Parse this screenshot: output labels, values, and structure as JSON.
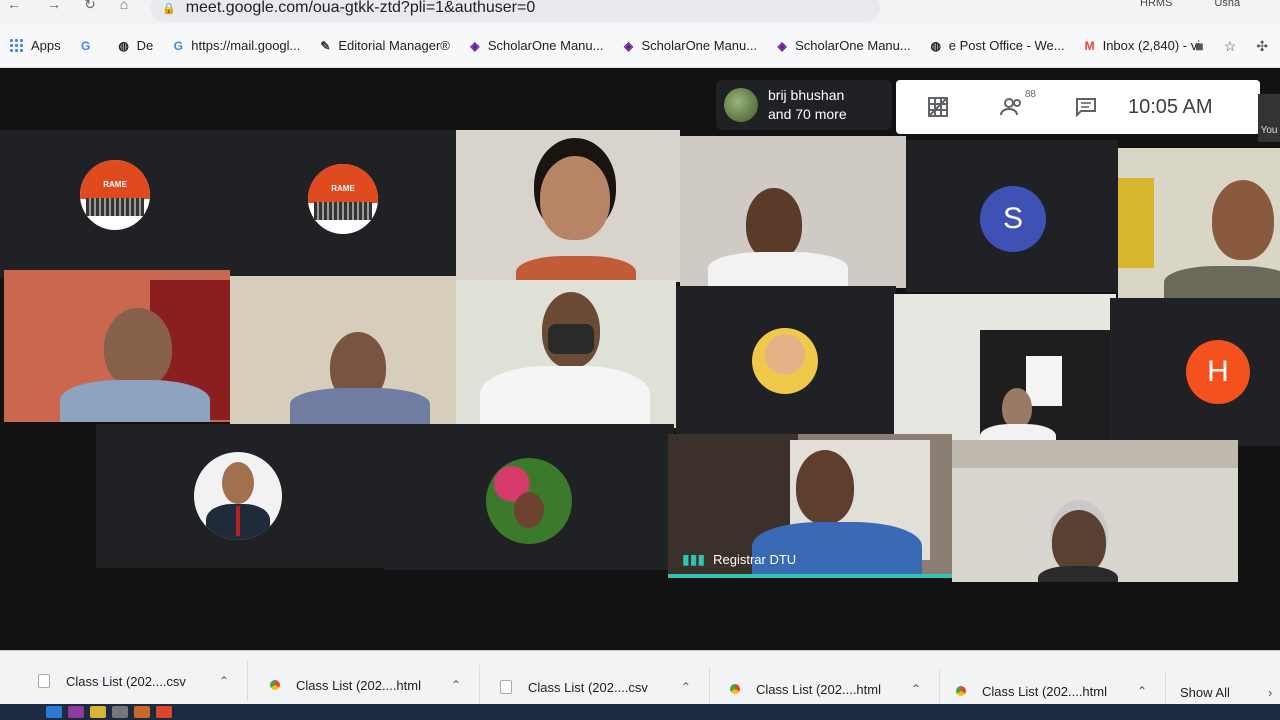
{
  "browser": {
    "url": "meet.google.com/oua-gtkk-ztd?pli=1&authuser=0",
    "profile_items": [
      "HRMS",
      "Usha"
    ],
    "bookmarks": [
      {
        "icon": "apps-icon",
        "label": "Apps"
      },
      {
        "icon": "google-icon",
        "label": ""
      },
      {
        "icon": "globe-icon",
        "label": "De"
      },
      {
        "icon": "google-icon",
        "label": "https://mail.googl..."
      },
      {
        "icon": "editorial-icon",
        "label": "Editorial Manager®"
      },
      {
        "icon": "scholarone-icon",
        "label": "ScholarOne Manu..."
      },
      {
        "icon": "scholarone-icon",
        "label": "ScholarOne Manu..."
      },
      {
        "icon": "scholarone-icon",
        "label": "ScholarOne Manu..."
      },
      {
        "icon": "globe-icon",
        "label": "e Post Office - We..."
      },
      {
        "icon": "gmail-icon",
        "label": "Inbox (2,840) - vi"
      }
    ]
  },
  "meet": {
    "presenter_pill": {
      "line1": "brij bhushan",
      "line2": "and 70 more"
    },
    "participants_count": "88",
    "time": "10:05 AM",
    "you_label": "You",
    "letter_avatars": [
      {
        "letter": "S",
        "color": "#3f51b5"
      },
      {
        "letter": "H",
        "color": "#f4511e"
      }
    ],
    "active_speaker": "Registrar DTU",
    "logo_text": "RAME",
    "logo_subtext": "NATIONAL CONF"
  },
  "downloads": {
    "items": [
      {
        "type": "csv",
        "label": "Class List (202....csv"
      },
      {
        "type": "html",
        "label": "Class List (202....html"
      },
      {
        "type": "csv",
        "label": "Class List (202....csv"
      },
      {
        "type": "html",
        "label": "Class List (202....html"
      },
      {
        "type": "html",
        "label": "Class List (202....html"
      }
    ],
    "show_all": "Show All"
  }
}
